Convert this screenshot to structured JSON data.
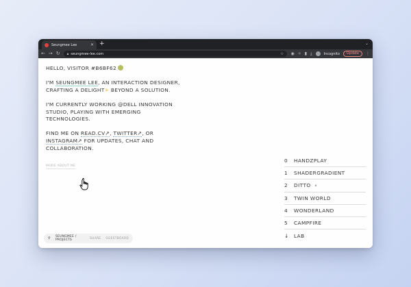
{
  "browser": {
    "tab_title": "Seungmee Lee",
    "new_tab": "+",
    "url": "seungmee-lee.com",
    "incognito_label": "Incognito",
    "update_label": "Update"
  },
  "intro": {
    "greeting": "HELLO, VISITOR #B6BF62",
    "hash_color": "#B6BF62",
    "p1_a": "I'M ",
    "p1_name": "SEUNGMEE LEE",
    "p1_b": ", AN INTERACTION DESIGNER, CRAFTING A DELIGHT",
    "p1_c": " BEYOND A SOLUTION.",
    "p2": "I'M CURRENTLY WORKING @DELL INNOVATION STUDIO, PLAYING WITH EMERGING TECHNOLOGIES.",
    "p3_a": "FIND ME ON ",
    "p3_readcv": "READ.CV↗",
    "p3_sep1": ", ",
    "p3_twitter": "TWITTER↗",
    "p3_sep2": ", OR ",
    "p3_instagram": "INSTAGRAM↗",
    "p3_b": " FOR UPDATES, CHAT AND COLLABORATION."
  },
  "more_about": "MORE ABOUT ME",
  "projects": [
    {
      "num": "0",
      "name": "HANDZPLAY"
    },
    {
      "num": "1",
      "name": "SHADERGRADIENT"
    },
    {
      "num": "2",
      "name": "DITTO"
    },
    {
      "num": "3",
      "name": "TWIN WORLD"
    },
    {
      "num": "4",
      "name": "WONDERLAND"
    },
    {
      "num": "5",
      "name": "CAMPFIRE"
    },
    {
      "num": "↓",
      "name": "LAB"
    }
  ],
  "bottom_bar": {
    "current": "SEUNGMEE / PROJECTS",
    "share": "SHARE",
    "guestboard": "GUESTBOARD"
  }
}
